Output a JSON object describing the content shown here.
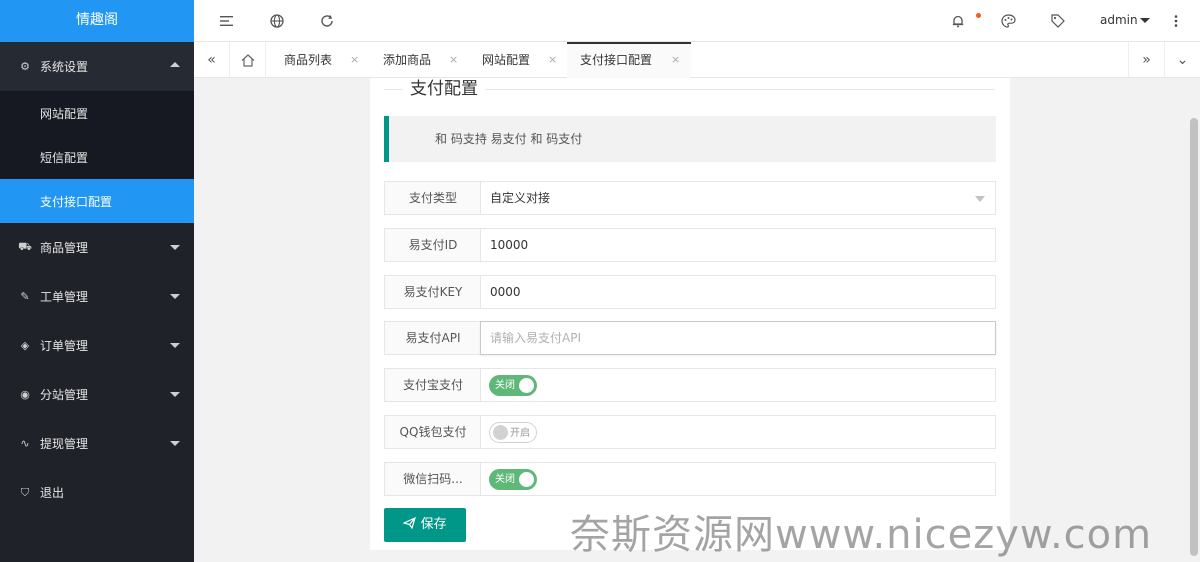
{
  "sidebar": {
    "logo": "情趣阁",
    "menu": [
      {
        "label": "系统设置",
        "icon": "gear-icon",
        "glyph": "⚙"
      },
      {
        "label": "商品管理",
        "icon": "cart-icon",
        "glyph": "🛒"
      },
      {
        "label": "工单管理",
        "icon": "ticket-icon",
        "glyph": "✎"
      },
      {
        "label": "订单管理",
        "icon": "stack-icon",
        "glyph": "◈"
      },
      {
        "label": "分站管理",
        "icon": "globe-icon",
        "glyph": "◉"
      },
      {
        "label": "提现管理",
        "icon": "pulse-icon",
        "glyph": "∿"
      },
      {
        "label": "退出",
        "icon": "shield-icon",
        "glyph": "⛉"
      }
    ],
    "submenu": [
      "网站配置",
      "短信配置",
      "支付接口配置"
    ]
  },
  "topbar": {
    "icons": [
      "menu-fold-icon",
      "globe-icon",
      "refresh-icon",
      "bell-icon",
      "palette-icon",
      "tag-icon",
      "more-vertical-icon"
    ],
    "user": "admin"
  },
  "tabs": {
    "items": [
      "商品列表",
      "添加商品",
      "网站配置",
      "支付接口配置"
    ],
    "active": "支付接口配置",
    "close": "×"
  },
  "form": {
    "legend": "支付配置",
    "notice": "和 码支持 易支付 和 码支付",
    "pay_type": {
      "label": "支付类型",
      "value": "自定义对接"
    },
    "pid": {
      "label": "易支付ID",
      "value": "10000"
    },
    "key": {
      "label": "易支付KEY",
      "value": "0000"
    },
    "api": {
      "label": "易支付API",
      "placeholder": "请输入易支付API"
    },
    "alipay": {
      "label": "支付宝支付",
      "state": "关闭"
    },
    "qqpay": {
      "label": "QQ钱包支付",
      "state": "开启"
    },
    "wxpay": {
      "label": "微信扫码...",
      "state": "关闭"
    },
    "save": "保存"
  },
  "watermark": "奈斯资源网www.nicezyw.com",
  "colors": {
    "accent": "#2196f3",
    "primary_button": "#009688",
    "switch_on": "#5fb878",
    "sidebar_bg": "#20222a"
  }
}
